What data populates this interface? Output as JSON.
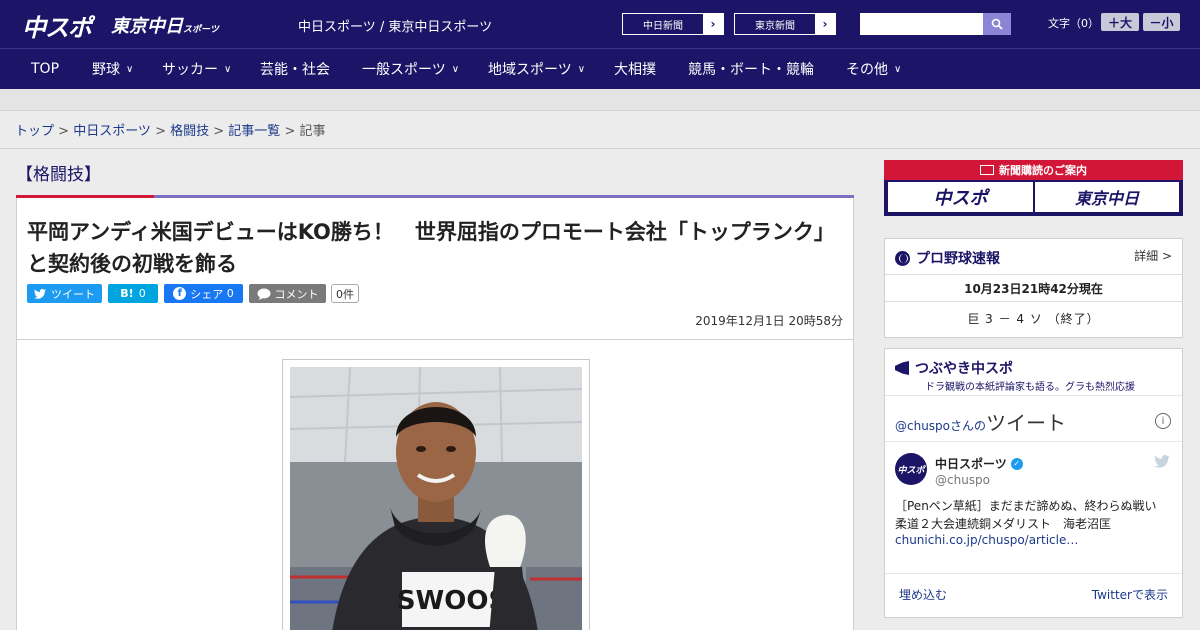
{
  "header": {
    "logo_chuspo": "中スポ",
    "logo_tokyo": "東京中日",
    "logo_tokyo_small": "スポーツ",
    "site_links": "中日スポーツ / 東京中日スポーツ",
    "ext_links": [
      {
        "label": "中日新聞",
        "arrow": "›"
      },
      {
        "label": "東京新聞",
        "arrow": "›"
      }
    ],
    "search_placeholder": "",
    "font_size_label": "文字（0）",
    "font_plus": "＋大",
    "font_minus": "－小"
  },
  "nav": {
    "items": [
      {
        "label": "TOP",
        "dropdown": false
      },
      {
        "label": "野球",
        "dropdown": true
      },
      {
        "label": "サッカー",
        "dropdown": true
      },
      {
        "label": "芸能・社会",
        "dropdown": false
      },
      {
        "label": "一般スポーツ",
        "dropdown": true
      },
      {
        "label": "地域スポーツ",
        "dropdown": true
      },
      {
        "label": "大相撲",
        "dropdown": false
      },
      {
        "label": "競馬・ボート・競輪",
        "dropdown": false
      },
      {
        "label": "その他",
        "dropdown": true
      }
    ],
    "chevron": "∨"
  },
  "breadcrumb": {
    "items": [
      "トップ",
      "中日スポーツ",
      "格闘技",
      "記事一覧"
    ],
    "sep": " > ",
    "current": "記事"
  },
  "article": {
    "category": "【格闘技】",
    "headline": "平岡アンディ米国デビューはKO勝ち！　世界屈指のプロモート会社「トップランク」と契約後の初戦を飾る",
    "share": {
      "tweet": "ツイート",
      "tweet_icon": "🐦",
      "hatena_icon": "B!",
      "hatena_count": "0",
      "fb_icon": "f",
      "fb_label": "シェア",
      "fb_count": "0",
      "comment_label": "コメント",
      "comment_count": "0件"
    },
    "date": "2019年12月1日 20時58分",
    "photo_shirt_text": "SWOOS"
  },
  "sidebar": {
    "ad": {
      "top": "新聞購読のご案内",
      "logo1": "中スポ",
      "logo2": "東京中日"
    },
    "score": {
      "title": "プロ野球速報",
      "detail": "詳細 >",
      "time": "10月23日21時42分現在",
      "result": "巨 3 － 4 ソ （終了）"
    },
    "twitter": {
      "title": "つぶやき中スポ",
      "subtitle": "ドラ観戦の本紙評論家も語る。グラも熱烈応援",
      "handle_prefix": "@chuspo",
      "handle_suffix": "さんの",
      "tweets_word": "ツイート",
      "info": "i",
      "avatar_text": "中スポ",
      "name": "中日スポーツ",
      "verified": "✓",
      "handle": "@chuspo",
      "text": "［Penペン草紙］まだまだ諦めぬ、終わらぬ戦い　柔道２大会連続銅メダリスト　海老沼匡",
      "link": "chunichi.co.jp/chuspo/article…",
      "embed": "埋め込む",
      "view": "Twitterで表示"
    }
  },
  "colors": {
    "brand_navy": "#1c1466",
    "accent_red": "#d21638",
    "twitter_blue": "#1d9bf0",
    "hatena_blue": "#00a4de",
    "fb_blue": "#1877f2"
  }
}
